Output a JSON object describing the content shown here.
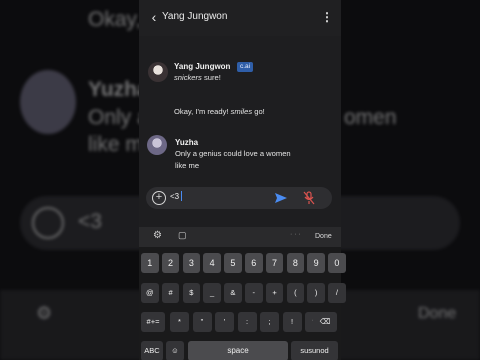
{
  "header": {
    "title": "Yang Jungwon",
    "back_icon": "chevron-left-icon",
    "menu_icon": "more-vert-icon"
  },
  "messages": [
    {
      "author": "Yang Jungwon",
      "tag": "c.ai",
      "italic": "snickers",
      "text": " sure!"
    },
    {
      "author": "",
      "text_prefix": "Okay, I'm ready! ",
      "italic": "smiles",
      "text_suffix": " go!"
    },
    {
      "author": "Yuzha",
      "lines": [
        "Only a genius could love a women",
        "like me"
      ]
    }
  ],
  "composer": {
    "value": "<3",
    "send_icon": "send-icon",
    "mic_icon": "mic-off-icon",
    "attach_icon": "plus-circle-icon",
    "accent": "#4a8cf2"
  },
  "keyboard_toolbar": {
    "settings_icon": "gear-icon",
    "clipboard_icon": "chat-icon",
    "dots": "· · ·",
    "done": "Done"
  },
  "keyboard": {
    "row1": [
      "1",
      "2",
      "3",
      "4",
      "5",
      "6",
      "7",
      "8",
      "9",
      "0"
    ],
    "row2": [
      "@",
      "#",
      "$",
      "_",
      "&",
      "-",
      "+",
      "(",
      ")",
      "/"
    ],
    "row3": [
      "#+=",
      "*",
      "\"",
      "'",
      ":",
      ";",
      "!",
      "?",
      "⌫"
    ],
    "row4": [
      "ABC",
      "☺",
      "space",
      "susunod"
    ]
  },
  "backdrop": {
    "line1": "Okay,",
    "name": "Yuzha",
    "line2": "Only a",
    "line2b": "omen",
    "line3": "like m",
    "input": "<3",
    "done": "Done"
  }
}
